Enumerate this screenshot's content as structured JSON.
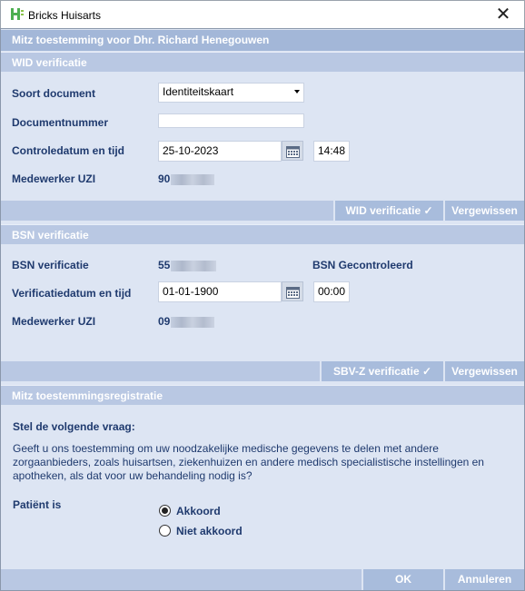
{
  "window": {
    "app_title": "Bricks Huisarts",
    "close_glyph": "✕"
  },
  "header": {
    "title": "Mitz toestemming voor Dhr. Richard Henegouwen"
  },
  "wid": {
    "section_title": "WID verificatie",
    "soort_document_label": "Soort document",
    "soort_document_value": "Identiteitskaart",
    "documentnummer_label": "Documentnummer",
    "documentnummer_value": "",
    "controledatum_label": "Controledatum en tijd",
    "controledatum_date": "25-10-2023",
    "controledatum_time": "14:48",
    "medewerker_label": "Medewerker UZI",
    "medewerker_value_prefix": "90",
    "verify_button": "WID  verificatie ✓",
    "confirm_button": "Vergewissen"
  },
  "bsn": {
    "section_title": "BSN verificatie",
    "bsn_label": "BSN verificatie",
    "bsn_value_prefix": "55",
    "bsn_status": "BSN Gecontroleerd",
    "verificatiedatum_label": "Verificatiedatum en tijd",
    "verificatiedatum_date": "01-01-1900",
    "verificatiedatum_time": "00:00",
    "medewerker_label": "Medewerker UZI",
    "medewerker_value_prefix": "09",
    "verify_button": "SBV-Z  verificatie ✓",
    "confirm_button": "Vergewissen"
  },
  "mitz": {
    "section_title": "Mitz toestemmingsregistratie",
    "question_heading": "Stel de volgende vraag:",
    "question_text": "Geeft u ons toestemming om uw noodzakelijke medische gegevens te delen met andere zorgaanbieders, zoals huisartsen, ziekenhuizen en andere medisch specialistische instellingen en apotheken, als dat voor uw behandeling nodig is?",
    "patient_label": "Patiënt is",
    "options": [
      "Akkoord",
      "Niet akkoord"
    ],
    "selected": "Akkoord"
  },
  "footer": {
    "ok_button": "OK",
    "cancel_button": "Annuleren"
  },
  "colors": {
    "header": "#a3b7d8",
    "section": "#b9c8e3",
    "panel": "#dde5f3",
    "text": "#1f3a6e",
    "icon_green": "#4caf50"
  },
  "icons": {
    "app": "bricks-h-logo",
    "calendar": "calendar-icon",
    "close": "close-icon",
    "dropdown": "chevron-down-icon"
  }
}
